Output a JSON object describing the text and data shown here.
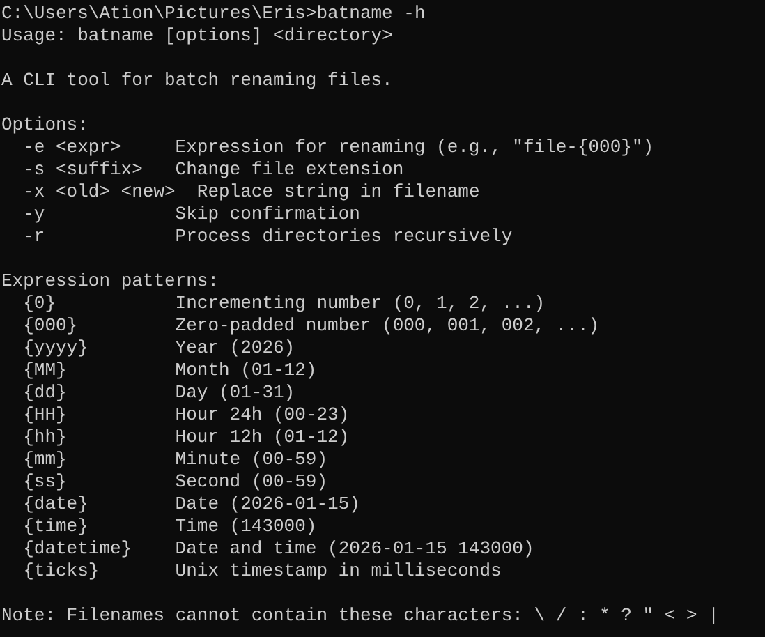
{
  "console": {
    "lines": [
      {
        "kind": "text",
        "text": "C:\\Users\\Ation\\Pictures\\Eris>batname -h"
      },
      {
        "kind": "text",
        "text": "Usage: batname [options] <directory>"
      },
      {
        "kind": "blank"
      },
      {
        "kind": "text",
        "text": "A CLI tool for batch renaming files."
      },
      {
        "kind": "blank"
      },
      {
        "kind": "text",
        "text": "Options:"
      },
      {
        "kind": "row",
        "term": "-e <expr>",
        "description": "Expression for renaming (e.g., \"file-{000}\")"
      },
      {
        "kind": "row",
        "term": "-s <suffix>",
        "description": "Change file extension"
      },
      {
        "kind": "row",
        "term": "-x <old> <new>",
        "description": "Replace string in filename"
      },
      {
        "kind": "row",
        "term": "-y",
        "description": "Skip confirmation"
      },
      {
        "kind": "row",
        "term": "-r",
        "description": "Process directories recursively"
      },
      {
        "kind": "blank"
      },
      {
        "kind": "text",
        "text": "Expression patterns:"
      },
      {
        "kind": "row",
        "term": "{0}",
        "description": "Incrementing number (0, 1, 2, ...)"
      },
      {
        "kind": "row",
        "term": "{000}",
        "description": "Zero-padded number (000, 001, 002, ...)"
      },
      {
        "kind": "row",
        "term": "{yyyy}",
        "description": "Year (2026)"
      },
      {
        "kind": "row",
        "term": "{MM}",
        "description": "Month (01-12)"
      },
      {
        "kind": "row",
        "term": "{dd}",
        "description": "Day (01-31)"
      },
      {
        "kind": "row",
        "term": "{HH}",
        "description": "Hour 24h (00-23)"
      },
      {
        "kind": "row",
        "term": "{hh}",
        "description": "Hour 12h (01-12)"
      },
      {
        "kind": "row",
        "term": "{mm}",
        "description": "Minute (00-59)"
      },
      {
        "kind": "row",
        "term": "{ss}",
        "description": "Second (00-59)"
      },
      {
        "kind": "row",
        "term": "{date}",
        "description": "Date (2026-01-15)"
      },
      {
        "kind": "row",
        "term": "{time}",
        "description": "Time (143000)"
      },
      {
        "kind": "row",
        "term": "{datetime}",
        "description": "Date and time (2026-01-15 143000)"
      },
      {
        "kind": "row",
        "term": "{ticks}",
        "description": "Unix timestamp in milliseconds"
      },
      {
        "kind": "blank"
      },
      {
        "kind": "text",
        "text": "Note: Filenames cannot contain these characters: \\ / : * ? \" < > |"
      }
    ]
  }
}
